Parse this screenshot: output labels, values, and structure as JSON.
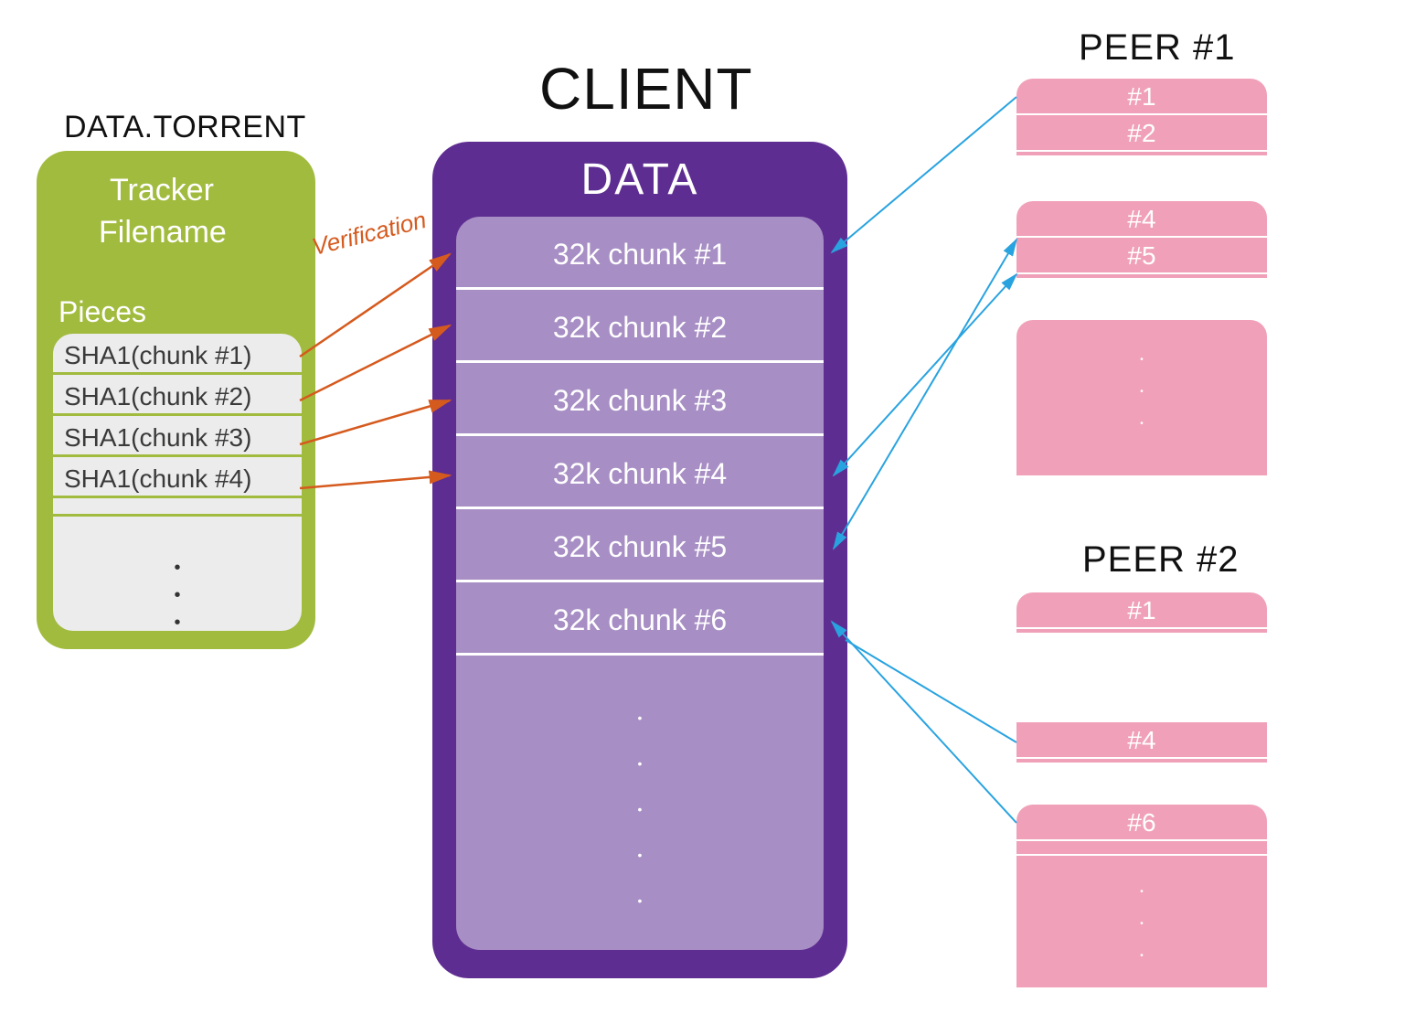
{
  "torrent": {
    "title": "DATA.TORRENT",
    "tracker_label": "Tracker",
    "filename_label": "Filename",
    "pieces_title": "Pieces",
    "sha_rows": [
      "SHA1(chunk #1)",
      "SHA1(chunk #2)",
      "SHA1(chunk #3)",
      "SHA1(chunk #4)"
    ]
  },
  "client": {
    "title": "CLIENT",
    "data_title": "DATA",
    "chunks": [
      "32k chunk #1",
      "32k chunk #2",
      "32k chunk #3",
      "32k chunk #4",
      "32k chunk #5",
      "32k chunk #6"
    ]
  },
  "peers": {
    "peer1": {
      "title": "PEER #1",
      "block1": [
        "#1",
        "#2"
      ],
      "block2": [
        "#4",
        "#5"
      ]
    },
    "peer2": {
      "title": "PEER #2",
      "block1": [
        "#1"
      ],
      "block2": [
        "#4"
      ],
      "block3": [
        "#6"
      ]
    }
  },
  "labels": {
    "verification": "Verification"
  },
  "colors": {
    "torrent_bg": "#a1bb3e",
    "client_outer": "#5e2d91",
    "client_inner": "#a78ec4",
    "peer_bg": "#f0a1b9",
    "verify_arrow": "#d55a1e",
    "transfer_arrow": "#29a3e0"
  }
}
